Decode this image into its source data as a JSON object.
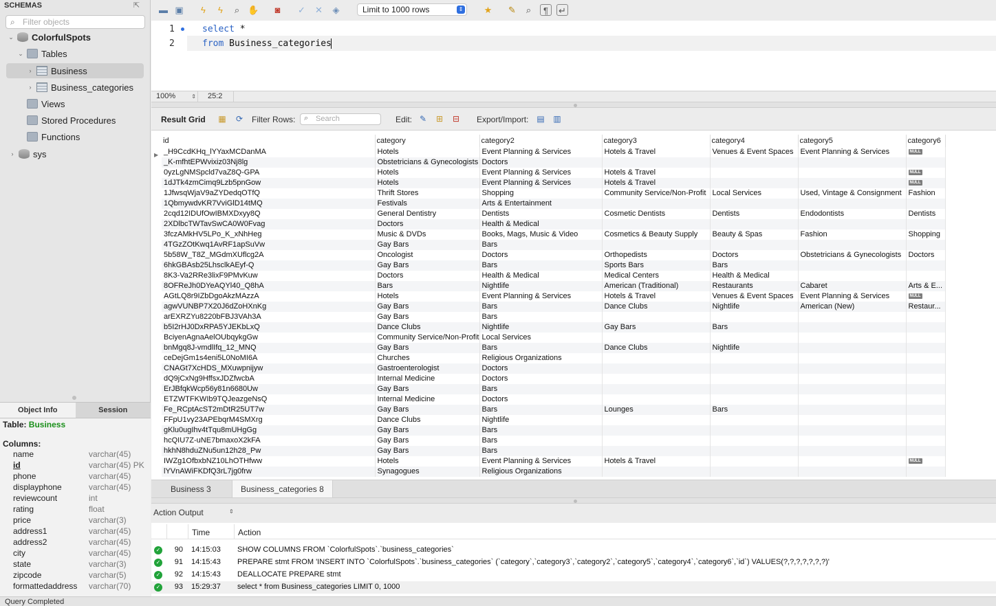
{
  "sidebar": {
    "title": "SCHEMAS",
    "filter_placeholder": "Filter objects",
    "tree": {
      "schema1": "ColorfulSpots",
      "tables_folder": "Tables",
      "table1": "Business",
      "table2": "Business_categories",
      "views": "Views",
      "procedures": "Stored Procedures",
      "functions": "Functions",
      "schema2": "sys"
    },
    "tabs": {
      "object_info": "Object Info",
      "session": "Session"
    },
    "info": {
      "table_prefix": "Table:",
      "table_name": "Business",
      "columns_label": "Columns:",
      "columns": [
        {
          "name": "name",
          "type": "varchar(45)"
        },
        {
          "name": "id",
          "type": "varchar(45) PK"
        },
        {
          "name": "phone",
          "type": "varchar(45)"
        },
        {
          "name": "displayphone",
          "type": "varchar(45)"
        },
        {
          "name": "reviewcount",
          "type": "int"
        },
        {
          "name": "rating",
          "type": "float"
        },
        {
          "name": "price",
          "type": "varchar(3)"
        },
        {
          "name": "address1",
          "type": "varchar(45)"
        },
        {
          "name": "address2",
          "type": "varchar(45)"
        },
        {
          "name": "city",
          "type": "varchar(45)"
        },
        {
          "name": "state",
          "type": "varchar(3)"
        },
        {
          "name": "zipcode",
          "type": "varchar(5)"
        },
        {
          "name": "formattedaddress",
          "type": "varchar(70)"
        }
      ]
    }
  },
  "toolbar": {
    "limit_label": "Limit to 1000 rows"
  },
  "editor": {
    "line1_no": "1",
    "line2_no": "2",
    "line1_kw": "select",
    "line1_rest": " *",
    "line2_kw": "from",
    "line2_rest": " Business_categories",
    "zoom": "100%",
    "cursor": "25:2"
  },
  "result_toolbar": {
    "grid_label": "Result Grid",
    "filter_label": "Filter Rows:",
    "search_placeholder": "Search",
    "edit_label": "Edit:",
    "export_label": "Export/Import:"
  },
  "grid": {
    "null_text": "NULL",
    "columns": [
      "id",
      "category",
      "category2",
      "category3",
      "category4",
      "category5",
      "category6"
    ],
    "rows": [
      [
        "_H9CcdKHq_lYYaxMCDanMA",
        "Hotels",
        "Event Planning & Services",
        "Hotels & Travel",
        "Venues & Event Spaces",
        "Event Planning & Services",
        null
      ],
      [
        "_K-mfhtEPWvixiz03Nj8lg",
        "Obstetricians & Gynecologists",
        "Doctors",
        "",
        "",
        "",
        ""
      ],
      [
        "0yzLgNMSpcld7vaZ8Q-GPA",
        "Hotels",
        "Event Planning & Services",
        "Hotels & Travel",
        "",
        "",
        null
      ],
      [
        "1dJTk4zmCimq9Lzb5pnGow",
        "Hotels",
        "Event Planning & Services",
        "Hotels & Travel",
        "",
        "",
        null
      ],
      [
        "1JfwsqWjaV9aZYDedqOTfQ",
        "Thrift Stores",
        "Shopping",
        "Community Service/Non-Profit",
        "Local Services",
        "Used, Vintage & Consignment",
        "Fashion"
      ],
      [
        "1QbmywdvKR7VviGlD14tMQ",
        "Festivals",
        "Arts & Entertainment",
        "",
        "",
        "",
        ""
      ],
      [
        "2cqd12IDUfOwIBMXDxyy8Q",
        "General Dentistry",
        "Dentists",
        "Cosmetic Dentists",
        "Dentists",
        "Endodontists",
        "Dentists"
      ],
      [
        "2XDlbcTWTavSwCA0W0Fvag",
        "Doctors",
        "Health & Medical",
        "",
        "",
        "",
        ""
      ],
      [
        "3fczAMkHV5LPo_K_xNhHeg",
        "Music & DVDs",
        "Books, Mags, Music & Video",
        "Cosmetics & Beauty Supply",
        "Beauty & Spas",
        "Fashion",
        "Shopping"
      ],
      [
        "4TGzZOtKwq1AvRF1apSuVw",
        "Gay Bars",
        "Bars",
        "",
        "",
        "",
        ""
      ],
      [
        "5b58W_T8Z_MGdmXUflcg2A",
        "Oncologist",
        "Doctors",
        "Orthopedists",
        "Doctors",
        "Obstetricians & Gynecologists",
        "Doctors"
      ],
      [
        "6hkGBAsb25LhsclkAEyf-Q",
        "Gay Bars",
        "Bars",
        "Sports Bars",
        "Bars",
        "",
        ""
      ],
      [
        "8K3-Va2RRe3lixF9PMvKuw",
        "Doctors",
        "Health & Medical",
        "Medical Centers",
        "Health & Medical",
        "",
        ""
      ],
      [
        "8OFReJh0DYeAQYl40_Q8hA",
        "Bars",
        "Nightlife",
        "American (Traditional)",
        "Restaurants",
        "Cabaret",
        "Arts & E..."
      ],
      [
        "AGtLQ8r9IZbDgoAkzMAzzA",
        "Hotels",
        "Event Planning & Services",
        "Hotels & Travel",
        "Venues & Event Spaces",
        "Event Planning & Services",
        null
      ],
      [
        "agwVUNBP7X20J6dZoHXnKg",
        "Gay Bars",
        "Bars",
        "Dance Clubs",
        "Nightlife",
        "American (New)",
        "Restaur..."
      ],
      [
        "arEXRZYu8220bFBJ3VAh3A",
        "Gay Bars",
        "Bars",
        "",
        "",
        "",
        ""
      ],
      [
        "b5I2rHJ0DxRPA5YJEKbLxQ",
        "Dance Clubs",
        "Nightlife",
        "Gay Bars",
        "Bars",
        "",
        ""
      ],
      [
        "BciyenAgnaAelOUbqykgGw",
        "Community Service/Non-Profit",
        "Local Services",
        "",
        "",
        "",
        ""
      ],
      [
        "bnMgq8J-vmdlIfq_12_MNQ",
        "Gay Bars",
        "Bars",
        "Dance Clubs",
        "Nightlife",
        "",
        ""
      ],
      [
        "ceDejGm1s4eni5L0NoMI6A",
        "Churches",
        "Religious Organizations",
        "",
        "",
        "",
        ""
      ],
      [
        "CNAGt7XcHDS_MXuwpnijyw",
        "Gastroenterologist",
        "Doctors",
        "",
        "",
        "",
        ""
      ],
      [
        "dQ9jCxNg9HffsxJDZfwcbA",
        "Internal Medicine",
        "Doctors",
        "",
        "",
        "",
        ""
      ],
      [
        "ErJBfqkWcp56y81n6680Uw",
        "Gay Bars",
        "Bars",
        "",
        "",
        "",
        ""
      ],
      [
        "ETZWTFKWIb9TQJeazgeNsQ",
        "Internal Medicine",
        "Doctors",
        "",
        "",
        "",
        ""
      ],
      [
        "Fe_RCptAcST2mDtR25UT7w",
        "Gay Bars",
        "Bars",
        "Lounges",
        "Bars",
        "",
        ""
      ],
      [
        "FFpU1vy23APEbqrM4SMXrg",
        "Dance Clubs",
        "Nightlife",
        "",
        "",
        "",
        ""
      ],
      [
        "gKlu0ugIhv4tTqu8mUHgGg",
        "Gay Bars",
        "Bars",
        "",
        "",
        "",
        ""
      ],
      [
        "hcQIU7Z-uNE7bmaxoX2kFA",
        "Gay Bars",
        "Bars",
        "",
        "",
        "",
        ""
      ],
      [
        "hkhN8hduZNu5un12h28_Pw",
        "Gay Bars",
        "Bars",
        "",
        "",
        "",
        ""
      ],
      [
        "IWZg1OfbxbNZ10LhOTHfww",
        "Hotels",
        "Event Planning & Services",
        "Hotels & Travel",
        "",
        "",
        null
      ],
      [
        "lYVnAWiFKDfQ3rL7jg0frw",
        "Synagogues",
        "Religious Organizations",
        "",
        "",
        "",
        ""
      ]
    ]
  },
  "result_tabs": [
    "Business 3",
    "Business_categories 8"
  ],
  "output": {
    "selector": "Action Output",
    "col_time": "Time",
    "col_action": "Action",
    "rows": [
      {
        "num": "90",
        "time": "14:15:03",
        "action": "SHOW COLUMNS FROM `ColorfulSpots`.`business_categories`"
      },
      {
        "num": "91",
        "time": "14:15:43",
        "action": "PREPARE stmt FROM 'INSERT INTO `ColorfulSpots`.`business_categories` (`category`,`category3`,`category2`,`category5`,`category4`,`category6`,`id`) VALUES(?,?,?,?,?,?,?)'"
      },
      {
        "num": "92",
        "time": "14:15:43",
        "action": "DEALLOCATE PREPARE stmt"
      },
      {
        "num": "93",
        "time": "15:29:37",
        "action": "select * from Business_categories LIMIT 0, 1000"
      }
    ]
  },
  "status": "Query Completed"
}
